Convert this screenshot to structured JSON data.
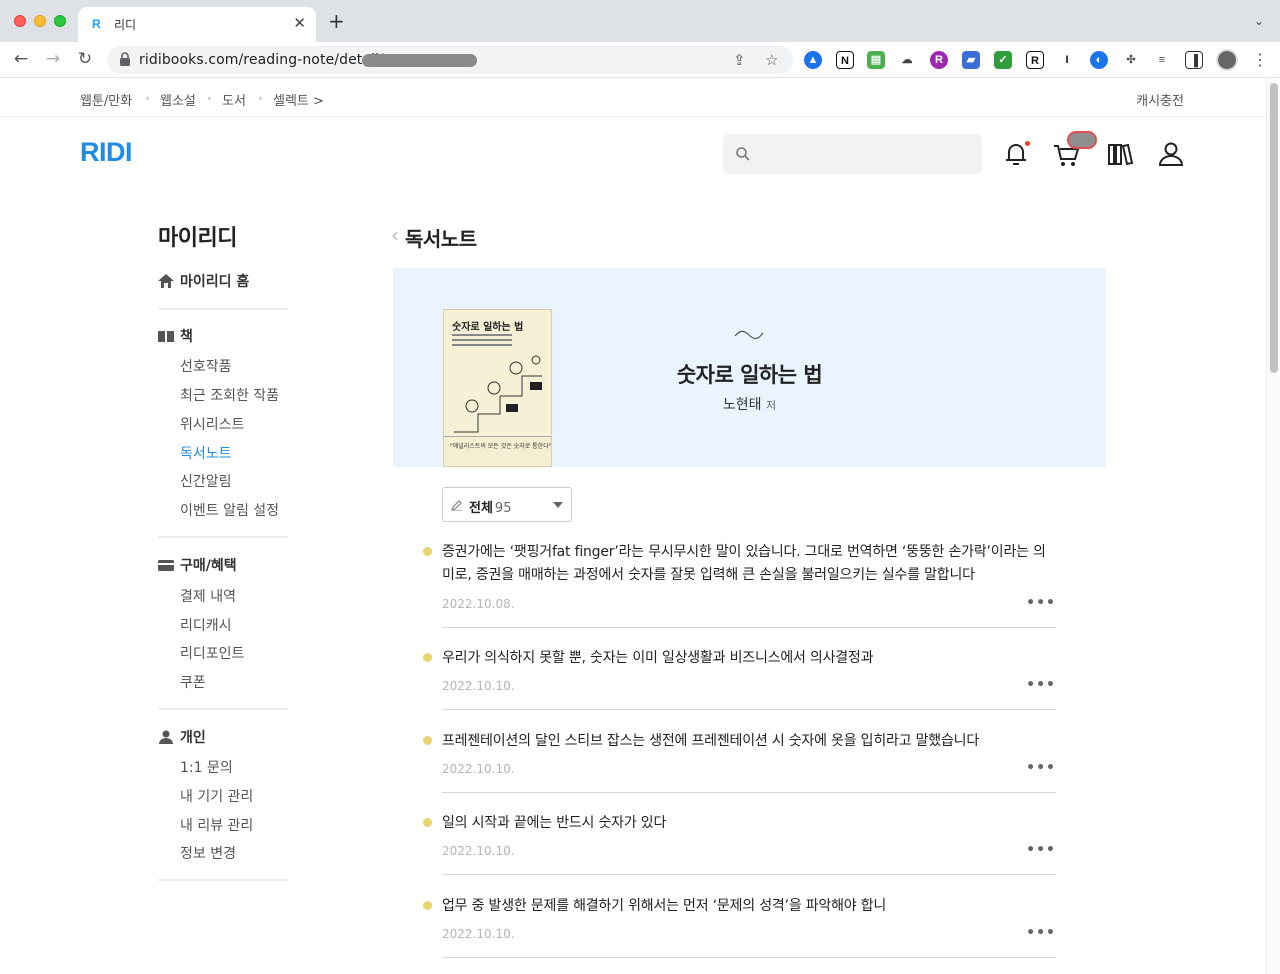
{
  "browser": {
    "tab_favicon": "R",
    "tab_title": "리디",
    "url": "ridibooks.com/reading-note/detail/"
  },
  "top_nav": {
    "links": [
      "웹툰/만화",
      "웹소설",
      "도서",
      "셀렉트 >"
    ],
    "cash_charge": "캐시충전"
  },
  "logo": "RIDI",
  "search": {
    "placeholder": ""
  },
  "sidebar": {
    "title": "마이리디",
    "home": "마이리디 홈",
    "groups": [
      {
        "label": "책",
        "icon": "book-icon",
        "items": [
          "선호작품",
          "최근 조회한 작품",
          "위시리스트",
          "독서노트",
          "신간알림",
          "이벤트 알림 설정"
        ]
      },
      {
        "label": "구매/혜택",
        "icon": "card-icon",
        "items": [
          "결제 내역",
          "리디캐시",
          "리디포인트",
          "쿠폰"
        ]
      },
      {
        "label": "개인",
        "icon": "person-icon",
        "items": [
          "1:1 문의",
          "내 기기 관리",
          "내 리뷰 관리",
          "정보 변경"
        ]
      }
    ],
    "active_item": "독서노트"
  },
  "content": {
    "title": "독서노트",
    "book": {
      "title": "숫자로 일하는 법",
      "author": "노현태",
      "author_suffix": "저",
      "cover_title": "숫자로 일하는 법",
      "cover_tagline": "\"애널리스트의 모든 것은 숫자로 통한다\""
    },
    "filter": {
      "label": "전체",
      "count": "95"
    },
    "notes": [
      {
        "text": "증권가에는 ‘팻핑거fat finger’라는 무시무시한 말이 있습니다. 그대로 번역하면 ‘뚱뚱한 손가락’이라는 의미로, 증권을 매매하는 과정에서 숫자를 잘못 입력해 큰 손실을 불러일으키는 실수를 말합니다",
        "date": "2022.10.08."
      },
      {
        "text": "우리가 의식하지 못할 뿐, 숫자는 이미 일상생활과 비즈니스에서 의사결정과",
        "date": "2022.10.10."
      },
      {
        "text": "프레젠테이션의 달인 스티브 잡스는 생전에 프레젠테이션 시 숫자에 옷을 입히라고 말했습니다",
        "date": "2022.10.10."
      },
      {
        "text": "일의 시작과 끝에는 반드시 숫자가 있다",
        "date": "2022.10.10."
      },
      {
        "text": "업무 중 발생한 문제를 해결하기 위해서는 먼저 ‘문제의 성격’을 파악해야 합니",
        "date": "2022.10.10."
      }
    ],
    "more_label": "•••"
  },
  "colors": {
    "brand": "#1f8ce6",
    "note_dot": "#e8d56f",
    "banner_bg": "#eaf4fe"
  }
}
